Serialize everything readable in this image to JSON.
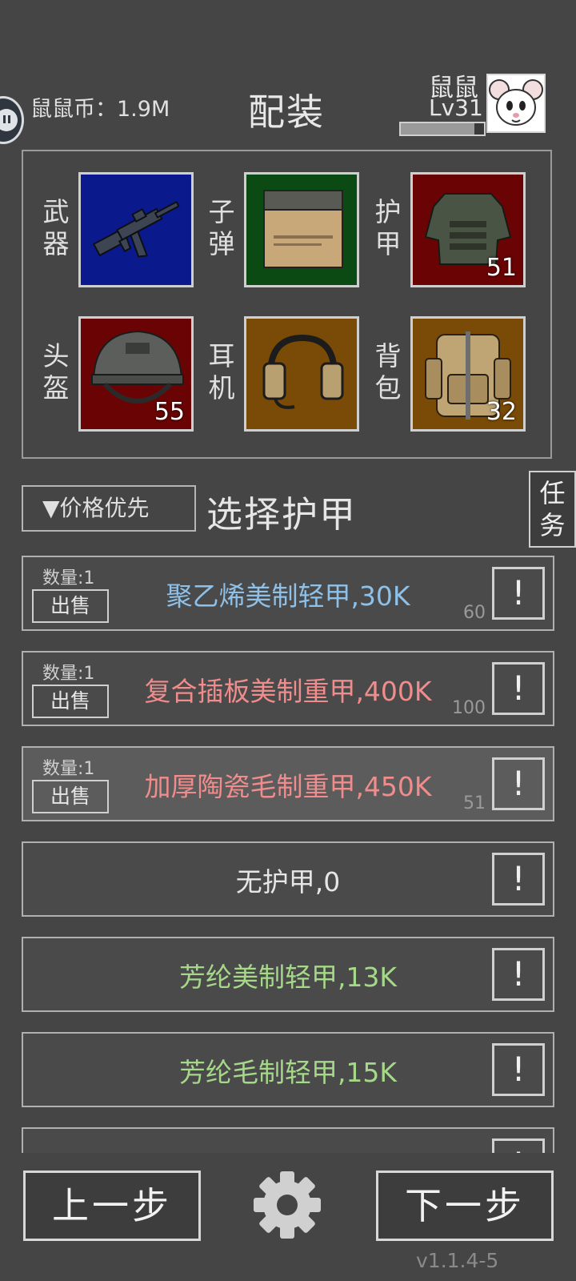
{
  "header": {
    "coins_label": "鼠鼠币：1.9M",
    "title": "配装",
    "user_name": "鼠鼠",
    "user_level": "Lv31",
    "xp_progress": 0.88
  },
  "loadout": {
    "slots": [
      {
        "label": "武\n器",
        "icon": "rifle-icon",
        "bg": "#0a1a8c",
        "level": ""
      },
      {
        "label": "子\n弹",
        "icon": "ammo-box-icon",
        "bg": "#0b4a12",
        "level": ""
      },
      {
        "label": "护\n甲",
        "icon": "vest-icon",
        "bg": "#6a0404",
        "level": "51"
      },
      {
        "label": "头\n盔",
        "icon": "helmet-icon",
        "bg": "#6a0404",
        "level": "55"
      },
      {
        "label": "耳\n机",
        "icon": "headset-icon",
        "bg": "#7a4b06",
        "level": ""
      },
      {
        "label": "背\n包",
        "icon": "backpack-icon",
        "bg": "#7a4b06",
        "level": "32"
      }
    ]
  },
  "filter": {
    "sort_label": "▼价格优先",
    "section_title": "选择护甲",
    "task_label": "任\n务"
  },
  "items": [
    {
      "qty": "数量:1",
      "sell": "出售",
      "name": "聚乙烯美制轻甲,30K",
      "color": "#8ec0e8",
      "level": "60",
      "info": "!",
      "selected": false
    },
    {
      "qty": "数量:1",
      "sell": "出售",
      "name": "复合插板美制重甲,400K",
      "color": "#f08c8c",
      "level": "100",
      "info": "!",
      "selected": false
    },
    {
      "qty": "数量:1",
      "sell": "出售",
      "name": "加厚陶瓷毛制重甲,450K",
      "color": "#f08c8c",
      "level": "51",
      "info": "!",
      "selected": true
    },
    {
      "qty": "",
      "sell": "",
      "name": "无护甲,0",
      "color": "#e6e6e6",
      "level": "",
      "info": "!",
      "selected": false
    },
    {
      "qty": "",
      "sell": "",
      "name": "芳纶美制轻甲,13K",
      "color": "#a6d88a",
      "level": "",
      "info": "!",
      "selected": false
    },
    {
      "qty": "",
      "sell": "",
      "name": "芳纶毛制轻甲,15K",
      "color": "#a6d88a",
      "level": "",
      "info": "!",
      "selected": false
    },
    {
      "qty": "",
      "sell": "",
      "name": "",
      "color": "#e6e6e6",
      "level": "",
      "info": "!",
      "selected": false
    }
  ],
  "footer": {
    "prev_label": "上一步",
    "next_label": "下一步",
    "version": "v1.1.4-5"
  }
}
